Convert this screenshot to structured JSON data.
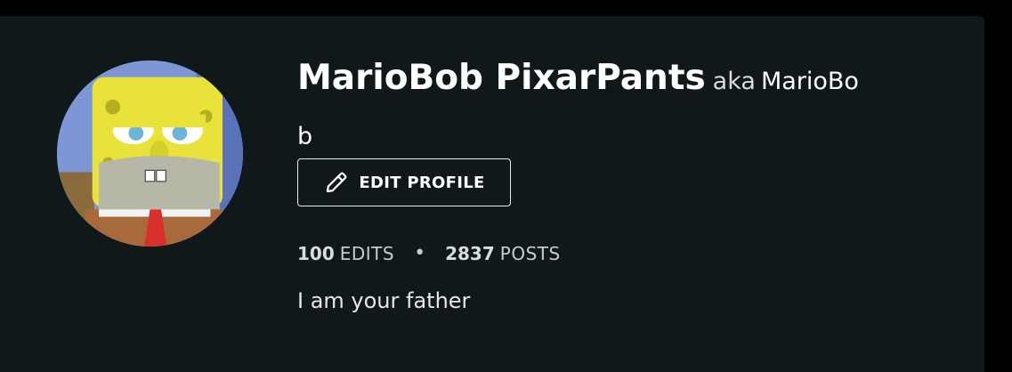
{
  "profile": {
    "display_name": "MarioBob PixarPants",
    "aka_label": "aka",
    "username_line1": "MarioBo",
    "username_line2": "b",
    "edit_button_label": "EDIT PROFILE",
    "edits_count": "100",
    "edits_label": "EDITS",
    "separator": "•",
    "posts_count": "2837",
    "posts_label": "POSTS",
    "bio": "I am your father"
  },
  "icons": {
    "avatar": "spongebob-avatar",
    "edit": "pencil-icon"
  },
  "colors": {
    "card_background": "#11181a",
    "page_background": "#000000",
    "text": "#ffffff"
  }
}
